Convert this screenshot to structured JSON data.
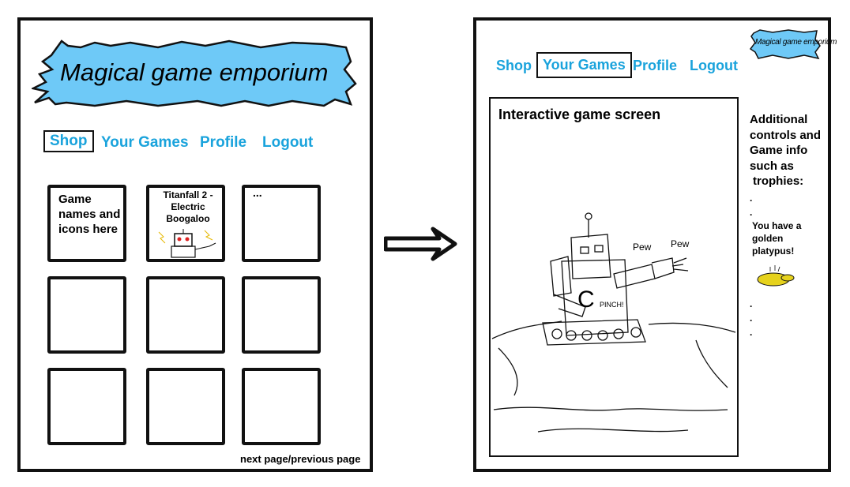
{
  "left_page": {
    "banner_title": "Magical game emporium",
    "nav": [
      "Shop",
      "Your Games",
      "Profile",
      "Logout"
    ],
    "tiles": [
      "Game names and icons here",
      "Titanfall 2 - Electric Boogaloo",
      "...",
      "",
      "",
      "",
      "",
      "",
      ""
    ],
    "pagination": "next page/previous page"
  },
  "right_page": {
    "banner_title": "Magical game emporium",
    "nav": [
      "Shop",
      "Your Games",
      "Profile",
      "Logout"
    ],
    "game_screen_title": "Interactive game screen",
    "sketch_labels": {
      "pew": "Pew",
      "pew2": "Pew",
      "pinch": "PINCH!",
      "letter": "C"
    },
    "sidebar": {
      "heading_lines": [
        "Additional",
        "controls and",
        "Game info",
        "such as",
        "trophies:"
      ],
      "dots_top": [
        ".",
        "."
      ],
      "trophy_lines": [
        "You have a",
        "golden",
        "platypus!"
      ],
      "dots_bottom": [
        ".",
        ".",
        "."
      ]
    }
  },
  "colors": {
    "accent": "#1aa3dc",
    "banner_fill": "#6ec9f7",
    "trophy": "#e6d21c"
  }
}
